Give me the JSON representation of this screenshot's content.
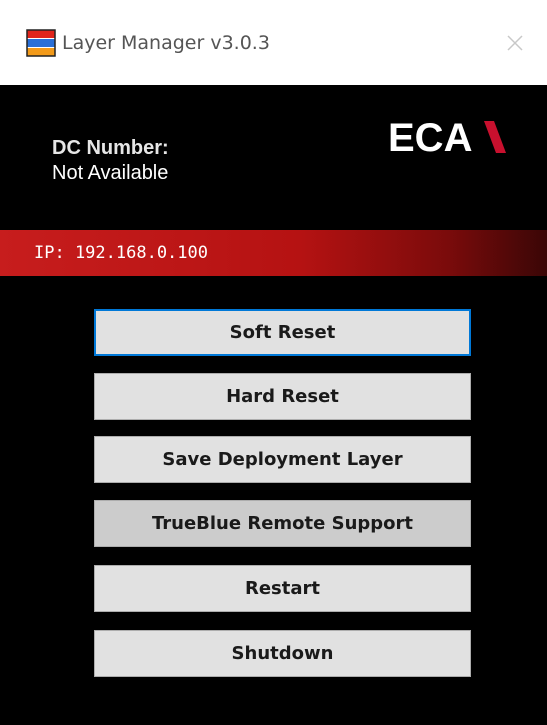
{
  "window": {
    "title": "Layer Manager v3.0.3",
    "app_icon": "layer-stack-icon",
    "close_icon": "close-icon"
  },
  "header": {
    "dc_label": "DC Number:",
    "dc_value": "Not Available",
    "logo_text": "ECA",
    "logo_icon": "eca-logo-icon"
  },
  "ip_bar": {
    "text": "IP: 192.168.0.100"
  },
  "buttons": {
    "soft_reset": "Soft Reset",
    "hard_reset": "Hard Reset",
    "save_deployment_layer": "Save Deployment Layer",
    "trueblue_remote_support": "TrueBlue Remote Support",
    "restart": "Restart",
    "shutdown": "Shutdown"
  },
  "colors": {
    "background": "#000000",
    "ip_bar_red": "#c71d1d",
    "button_face": "#e1e1e1",
    "button_hover": "#cccccc",
    "focus_border": "#0078d7",
    "logo_accent": "#c8102e"
  }
}
